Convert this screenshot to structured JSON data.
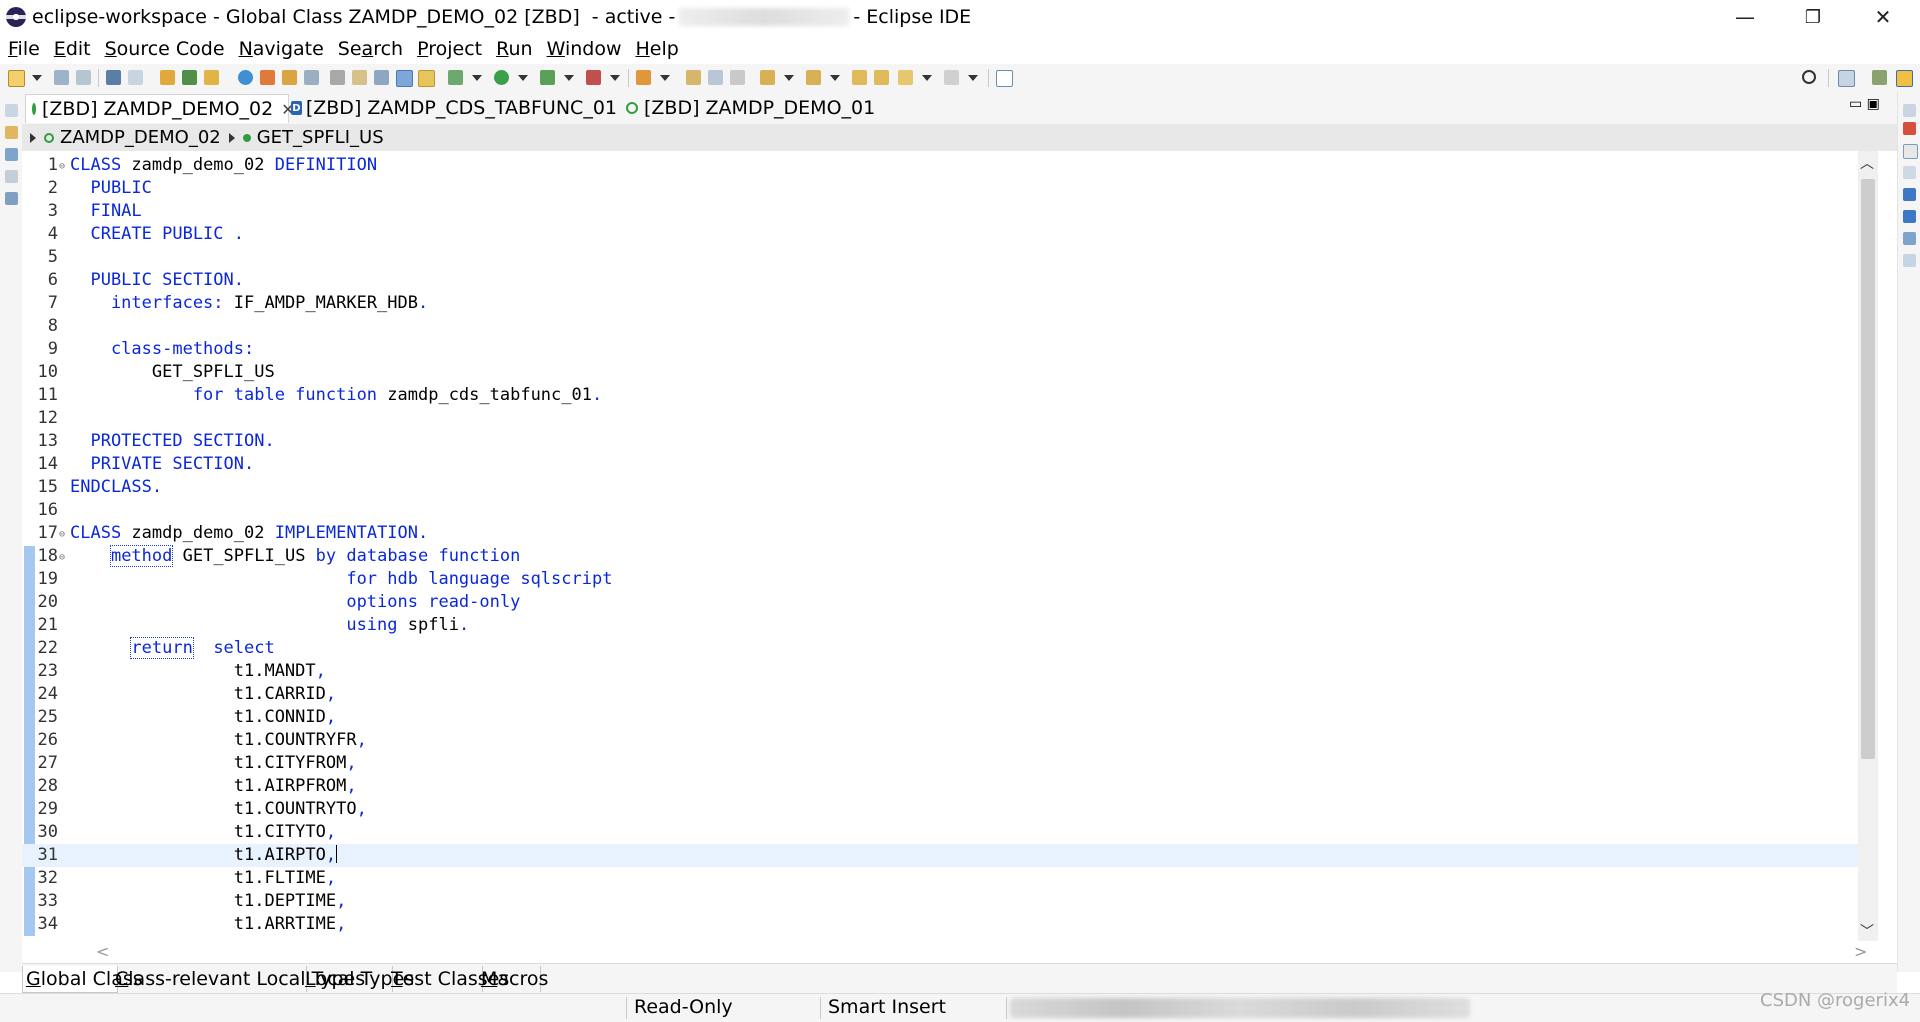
{
  "window": {
    "title": "eclipse-workspace - Global Class ZAMDP_DEMO_02 [ZBD]  - active -",
    "title_suffix": "- Eclipse IDE",
    "controls": {
      "minimize": "—",
      "restore": "❐",
      "close": "✕"
    }
  },
  "menu": [
    {
      "label": "File",
      "mnemonic": "F",
      "rest": "ile"
    },
    {
      "label": "Edit",
      "mnemonic": "E",
      "rest": "dit"
    },
    {
      "label": "Source Code",
      "mnemonic": "S",
      "rest": "ource Code"
    },
    {
      "label": "Navigate",
      "mnemonic": "N",
      "rest": "avigate"
    },
    {
      "label": "Search",
      "pre": "Se",
      "mnemonic": "a",
      "rest": "rch"
    },
    {
      "label": "Project",
      "mnemonic": "P",
      "rest": "roject"
    },
    {
      "label": "Run",
      "mnemonic": "R",
      "rest": "un"
    },
    {
      "label": "Window",
      "mnemonic": "W",
      "rest": "indow"
    },
    {
      "label": "Help",
      "mnemonic": "H",
      "rest": "elp"
    }
  ],
  "editor_tabs": [
    {
      "label": "[ZBD] ZAMDP_DEMO_02",
      "active": true,
      "icon": "class-icon",
      "closable": true
    },
    {
      "label": "[ZBD] ZAMDP_CDS_TABFUNC_01",
      "active": false,
      "icon": "ddl-icon",
      "icon_letter": "D"
    },
    {
      "label": "[ZBD] ZAMDP_DEMO_01",
      "active": false,
      "icon": "class-icon"
    }
  ],
  "breadcrumb": {
    "class_name": "ZAMDP_DEMO_02",
    "method_name": "GET_SPFLI_US"
  },
  "code_lines": [
    {
      "n": "1",
      "fold": true,
      "tokens": [
        [
          "kw",
          "CLASS "
        ],
        [
          "pl",
          "zamdp_demo_02 "
        ],
        [
          "kw",
          "DEFINITION"
        ]
      ]
    },
    {
      "n": "2",
      "tokens": [
        [
          "kw",
          "  PUBLIC"
        ]
      ]
    },
    {
      "n": "3",
      "tokens": [
        [
          "kw",
          "  FINAL"
        ]
      ]
    },
    {
      "n": "4",
      "tokens": [
        [
          "kw",
          "  CREATE PUBLIC ."
        ]
      ]
    },
    {
      "n": "5",
      "tokens": []
    },
    {
      "n": "6",
      "tokens": [
        [
          "kw",
          "  PUBLIC SECTION."
        ]
      ]
    },
    {
      "n": "7",
      "tokens": [
        [
          "kw",
          "    interfaces: "
        ],
        [
          "pl",
          "IF_AMDP_MARKER_HDB"
        ],
        [
          "kw",
          "."
        ]
      ]
    },
    {
      "n": "8",
      "tokens": []
    },
    {
      "n": "9",
      "tokens": [
        [
          "kw",
          "    class-methods:"
        ]
      ]
    },
    {
      "n": "10",
      "tokens": [
        [
          "pl",
          "        GET_SPFLI_US"
        ]
      ]
    },
    {
      "n": "11",
      "tokens": [
        [
          "kw",
          "            for table function "
        ],
        [
          "pl",
          "zamdp_cds_tabfunc_01"
        ],
        [
          "kw",
          "."
        ]
      ]
    },
    {
      "n": "12",
      "tokens": []
    },
    {
      "n": "13",
      "tokens": [
        [
          "kw",
          "  PROTECTED SECTION."
        ]
      ]
    },
    {
      "n": "14",
      "tokens": [
        [
          "kw",
          "  PRIVATE SECTION."
        ]
      ]
    },
    {
      "n": "15",
      "tokens": [
        [
          "kw",
          "ENDCLASS."
        ]
      ]
    },
    {
      "n": "16",
      "tokens": []
    },
    {
      "n": "17",
      "fold": true,
      "tokens": [
        [
          "kw",
          "CLASS "
        ],
        [
          "pl",
          "zamdp_demo_02 "
        ],
        [
          "kw",
          "IMPLEMENTATION."
        ]
      ]
    },
    {
      "n": "18",
      "fold": true,
      "tokens": [
        [
          "pl",
          "    "
        ],
        [
          "kwb",
          "method"
        ],
        [
          "pl",
          " GET_SPFLI_US "
        ],
        [
          "kw",
          "by database function"
        ]
      ]
    },
    {
      "n": "19",
      "tokens": [
        [
          "kw",
          "                           for hdb language sqlscript"
        ]
      ]
    },
    {
      "n": "20",
      "tokens": [
        [
          "kw",
          "                           options read-only"
        ]
      ]
    },
    {
      "n": "21",
      "tokens": [
        [
          "kw",
          "                           using "
        ],
        [
          "pl",
          "spfli"
        ],
        [
          "kw",
          "."
        ]
      ]
    },
    {
      "n": "22",
      "tokens": [
        [
          "pl",
          "      "
        ],
        [
          "kwb",
          "return"
        ],
        [
          "kw",
          "  select"
        ]
      ]
    },
    {
      "n": "23",
      "tokens": [
        [
          "pl",
          "                t1.MANDT"
        ],
        [
          "kw",
          ","
        ]
      ]
    },
    {
      "n": "24",
      "tokens": [
        [
          "pl",
          "                t1.CARRID"
        ],
        [
          "kw",
          ","
        ]
      ]
    },
    {
      "n": "25",
      "tokens": [
        [
          "pl",
          "                t1.CONNID"
        ],
        [
          "kw",
          ","
        ]
      ]
    },
    {
      "n": "26",
      "tokens": [
        [
          "pl",
          "                t1.COUNTRYFR"
        ],
        [
          "kw",
          ","
        ]
      ]
    },
    {
      "n": "27",
      "tokens": [
        [
          "pl",
          "                t1.CITYFROM"
        ],
        [
          "kw",
          ","
        ]
      ]
    },
    {
      "n": "28",
      "tokens": [
        [
          "pl",
          "                t1.AIRPFROM"
        ],
        [
          "kw",
          ","
        ]
      ]
    },
    {
      "n": "29",
      "tokens": [
        [
          "pl",
          "                t1.COUNTRYTO"
        ],
        [
          "kw",
          ","
        ]
      ]
    },
    {
      "n": "30",
      "tokens": [
        [
          "pl",
          "                t1.CITYTO"
        ],
        [
          "kw",
          ","
        ]
      ]
    },
    {
      "n": "31",
      "current": true,
      "tokens": [
        [
          "pl",
          "                t1.AIRPTO"
        ],
        [
          "kw",
          ","
        ],
        [
          "caret",
          ""
        ]
      ]
    },
    {
      "n": "32",
      "tokens": [
        [
          "pl",
          "                t1.FLTIME"
        ],
        [
          "kw",
          ","
        ]
      ]
    },
    {
      "n": "33",
      "tokens": [
        [
          "pl",
          "                t1.DEPTIME"
        ],
        [
          "kw",
          ","
        ]
      ]
    },
    {
      "n": "34",
      "tokens": [
        [
          "pl",
          "                t1.ARRTIME"
        ],
        [
          "kw",
          ","
        ]
      ]
    }
  ],
  "page_tabs": [
    {
      "label": "Global Class",
      "mnemonic": "G",
      "rest": "lobal Class",
      "active": true
    },
    {
      "label": "Class-relevant Local Types",
      "mnemonic": "C",
      "rest": "lass-relevant Local Types"
    },
    {
      "label": "Local Types",
      "mnemonic": "L",
      "rest": "ocal Types"
    },
    {
      "label": "Test Classes",
      "mnemonic": "T",
      "rest": "est Classes"
    },
    {
      "label": "Macros",
      "mnemonic": "M",
      "rest": "acros"
    }
  ],
  "status": {
    "mode": "Read-Only",
    "insert_mode": "Smart Insert"
  },
  "watermark": "CSDN @rogerix4",
  "colors": {
    "keyword": "#0a28d9",
    "plain": "#000000",
    "current_line": "#e8f2fe",
    "change_ruler": "#a5c8f0",
    "class_icon": "#2f9e3f"
  }
}
